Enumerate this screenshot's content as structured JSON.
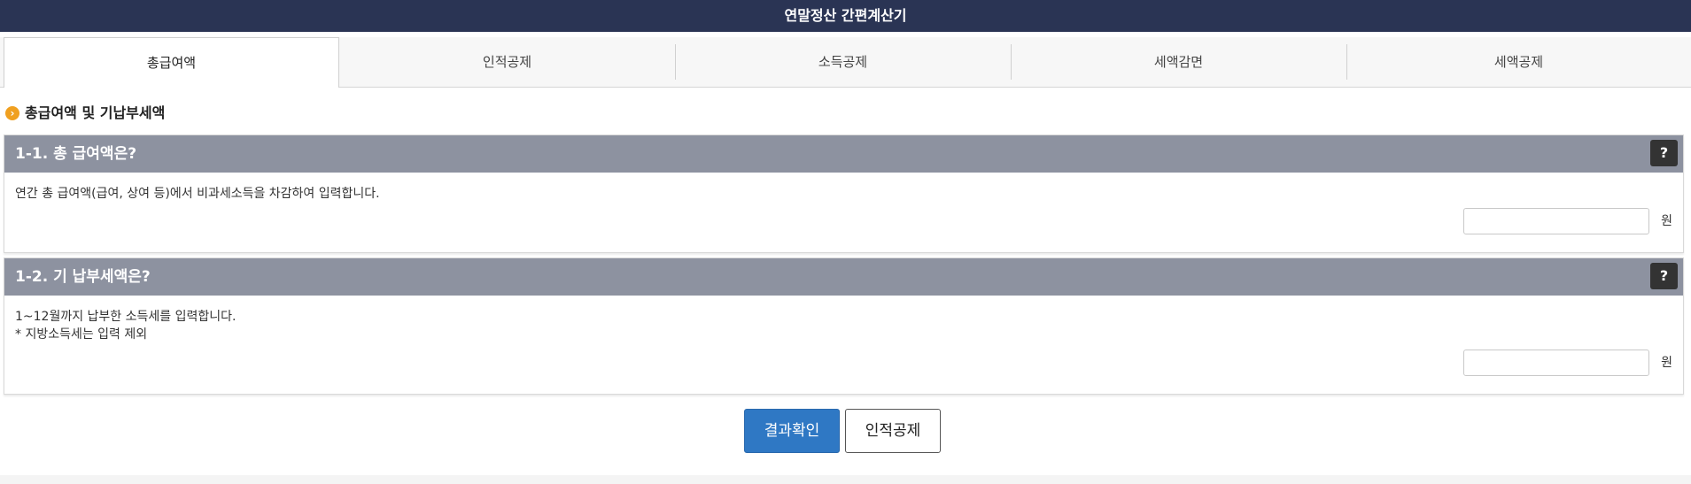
{
  "app": {
    "title": "연말정산 간편계산기"
  },
  "tabs": [
    {
      "label": "총급여액",
      "active": true
    },
    {
      "label": "인적공제",
      "active": false
    },
    {
      "label": "소득공제",
      "active": false
    },
    {
      "label": "세액감면",
      "active": false
    },
    {
      "label": "세액공제",
      "active": false
    }
  ],
  "section": {
    "bullet_icon": "chevron-right-icon",
    "bullet_glyph": "›",
    "title": "총급여액 및 기납부세액"
  },
  "questions": [
    {
      "title": "1-1. 총 급여액은?",
      "help_label": "?",
      "lines": [
        "연간 총 급여액(급여, 상여 등)에서 비과세소득을 차감하여 입력합니다."
      ],
      "input_value": "",
      "unit": "원"
    },
    {
      "title": "1-2. 기 납부세액은?",
      "help_label": "?",
      "lines": [
        "1~12월까지 납부한 소득세를 입력합니다.",
        "* 지방소득세는 입력 제외"
      ],
      "input_value": "",
      "unit": "원"
    }
  ],
  "actions": {
    "primary_label": "결과확인",
    "secondary_label": "인적공제"
  },
  "colors": {
    "topbar": "#2a3454",
    "question_header": "#8d92a0",
    "primary_button": "#2f78c4",
    "bullet": "#f0a020"
  }
}
